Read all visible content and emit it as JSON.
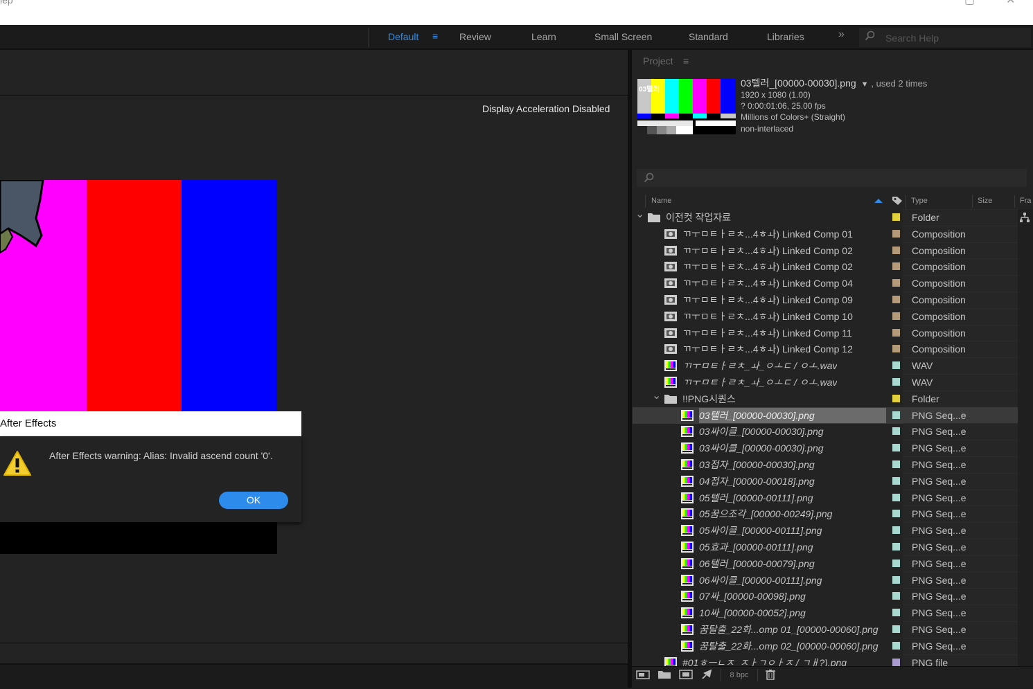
{
  "title_bar": {
    "menu_fragment": "lep"
  },
  "workspaces": {
    "items": [
      "Default",
      "Review",
      "Learn",
      "Small Screen",
      "Standard",
      "Libraries"
    ],
    "active": "Default",
    "more": "»",
    "search_placeholder": "Search Help"
  },
  "viewer": {
    "display_acceleration": "Display Acceleration Disabled",
    "colors": {
      "magenta": "#ff00ff",
      "red": "#ff0000",
      "blue": "#0000ff",
      "slate": "#4a5566",
      "olive": "#6b7a48"
    }
  },
  "dialog": {
    "title": "After Effects",
    "message": "After Effects warning: Alias: Invalid ascend count '0'.",
    "ok_label": "OK"
  },
  "project": {
    "tab_label": "Project",
    "tab_menu": "≡",
    "thumb_label": "03텔러",
    "selected_name": "03텔러_[00000-00030].png",
    "used": ", used 2 times",
    "info": [
      "1920 x 1080 (1.00)",
      "? 0:00:01:06, 25.00 fps",
      "Millions of Colors+ (Straight)",
      "non-interlaced"
    ],
    "columns": {
      "name": "Name",
      "type": "Type",
      "size": "Size",
      "frame": "Fra"
    },
    "rows": [
      {
        "name": "이전컷 작업자료",
        "type": "Folder",
        "label": "yellow"
      },
      {
        "name": "ㄲㅜㅁㅌㅏㄹㅊ...4ㅎㅘ) Linked Comp 01",
        "type": "Composition",
        "label": "tan"
      },
      {
        "name": "ㄲㅜㅁㅌㅏㄹㅊ...4ㅎㅘ) Linked Comp 02",
        "type": "Composition",
        "label": "tan"
      },
      {
        "name": "ㄲㅜㅁㅌㅏㄹㅊ...4ㅎㅘ) Linked Comp 02",
        "type": "Composition",
        "label": "tan"
      },
      {
        "name": "ㄲㅜㅁㅌㅏㄹㅊ...4ㅎㅘ) Linked Comp 04",
        "type": "Composition",
        "label": "tan"
      },
      {
        "name": "ㄲㅜㅁㅌㅏㄹㅊ...4ㅎㅘ) Linked Comp 09",
        "type": "Composition",
        "label": "tan"
      },
      {
        "name": "ㄲㅜㅁㅌㅏㄹㅊ...4ㅎㅘ) Linked Comp 10",
        "type": "Composition",
        "label": "tan"
      },
      {
        "name": "ㄲㅜㅁㅌㅏㄹㅊ...4ㅎㅘ) Linked Comp 11",
        "type": "Composition",
        "label": "tan"
      },
      {
        "name": "ㄲㅜㅁㅌㅏㄹㅊ...4ㅎㅘ) Linked Comp 12",
        "type": "Composition",
        "label": "tan"
      },
      {
        "name": "ㄲㅜㅁㅌㅏㄹㅊ_ㅘ_ㅇㅗㄷ / ㅇㅗ.wav",
        "type": "WAV",
        "label": "aqua"
      },
      {
        "name": "ㄲㅜㅁㅌㅏㄹㅊ_ㅘ_ㅇㅗㄷ / ㅇㅗ.wav",
        "type": "WAV",
        "label": "aqua"
      },
      {
        "name": "!!PNG시퀀스",
        "type": "Folder",
        "label": "yellow"
      },
      {
        "name": "03텔러_[00000-00030].png",
        "type": "PNG Seq...e",
        "label": "aqua"
      },
      {
        "name": "03싸이클_[00000-00030].png",
        "type": "PNG Seq...e",
        "label": "aqua"
      },
      {
        "name": "03싸이클_[00000-00030].png",
        "type": "PNG Seq...e",
        "label": "aqua"
      },
      {
        "name": "03접자_[00000-00030].png",
        "type": "PNG Seq...e",
        "label": "aqua"
      },
      {
        "name": "04접자_[00000-00018].png",
        "type": "PNG Seq...e",
        "label": "aqua"
      },
      {
        "name": "05텔러_[00000-00111].png",
        "type": "PNG Seq...e",
        "label": "aqua"
      },
      {
        "name": "05꿈으조각_[00000-00249].png",
        "type": "PNG Seq...e",
        "label": "aqua"
      },
      {
        "name": "05싸이클_[00000-00111].png",
        "type": "PNG Seq...e",
        "label": "aqua"
      },
      {
        "name": "05효과_[00000-00111].png",
        "type": "PNG Seq...e",
        "label": "aqua"
      },
      {
        "name": "06텔러_[00000-00079].png",
        "type": "PNG Seq...e",
        "label": "aqua"
      },
      {
        "name": "06싸이클_[00000-00111].png",
        "type": "PNG Seq...e",
        "label": "aqua"
      },
      {
        "name": "07싸_[00000-00098].png",
        "type": "PNG Seq...e",
        "label": "aqua"
      },
      {
        "name": "10싸_[00000-00052].png",
        "type": "PNG Seq...e",
        "label": "aqua"
      },
      {
        "name": "꿈탈출_22화...omp 01_[00000-00060].png",
        "type": "PNG Seq...e",
        "label": "aqua"
      },
      {
        "name": "꿈탈출_22화...omp 02_[00000-00060].png",
        "type": "PNG Seq...e",
        "label": "aqua"
      },
      {
        "name": "#01ㅎㅡㄴㅈ_ㅈㅏㄱㅇㅏㅈ / ㄱㅐ?).png",
        "type": "PNG file",
        "label": "lavender"
      }
    ],
    "bpc": "8 bpc",
    "label_colors": {
      "yellow": "#e2cf3c",
      "tan": "#b59a7a",
      "aqua": "#a9d8d0",
      "lavender": "#a99ad0"
    }
  }
}
